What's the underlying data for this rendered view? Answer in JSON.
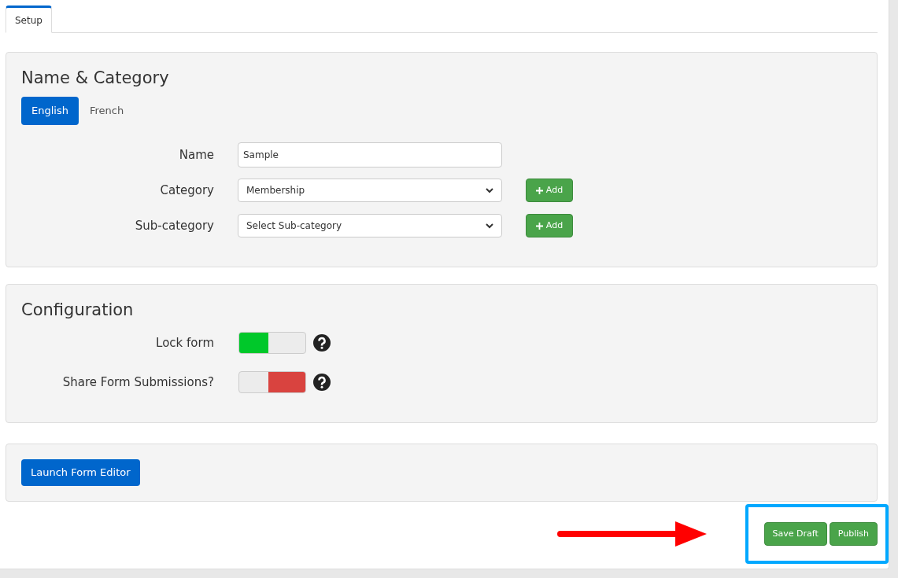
{
  "tabs": [
    {
      "label": "Setup",
      "selected": true
    }
  ],
  "name_category": {
    "title": "Name & Category",
    "languages": [
      {
        "label": "English",
        "selected": true
      },
      {
        "label": "French",
        "selected": false
      }
    ],
    "fields": [
      {
        "kind": "text",
        "label": "Name",
        "value": "Sample"
      },
      {
        "kind": "select",
        "label": "Category",
        "value": "Membership",
        "add_button": "Add"
      },
      {
        "kind": "select",
        "label": "Sub-category",
        "value": "Select Sub-category",
        "add_button": "Add"
      }
    ]
  },
  "configuration": {
    "title": "Configuration",
    "toggles": [
      {
        "label": "Lock form",
        "on": true
      },
      {
        "label": "Share Form Submissions?",
        "on": false
      }
    ]
  },
  "launch_button": "Launch Form Editor",
  "footer_buttons": [
    "Save Draft",
    "Publish"
  ]
}
